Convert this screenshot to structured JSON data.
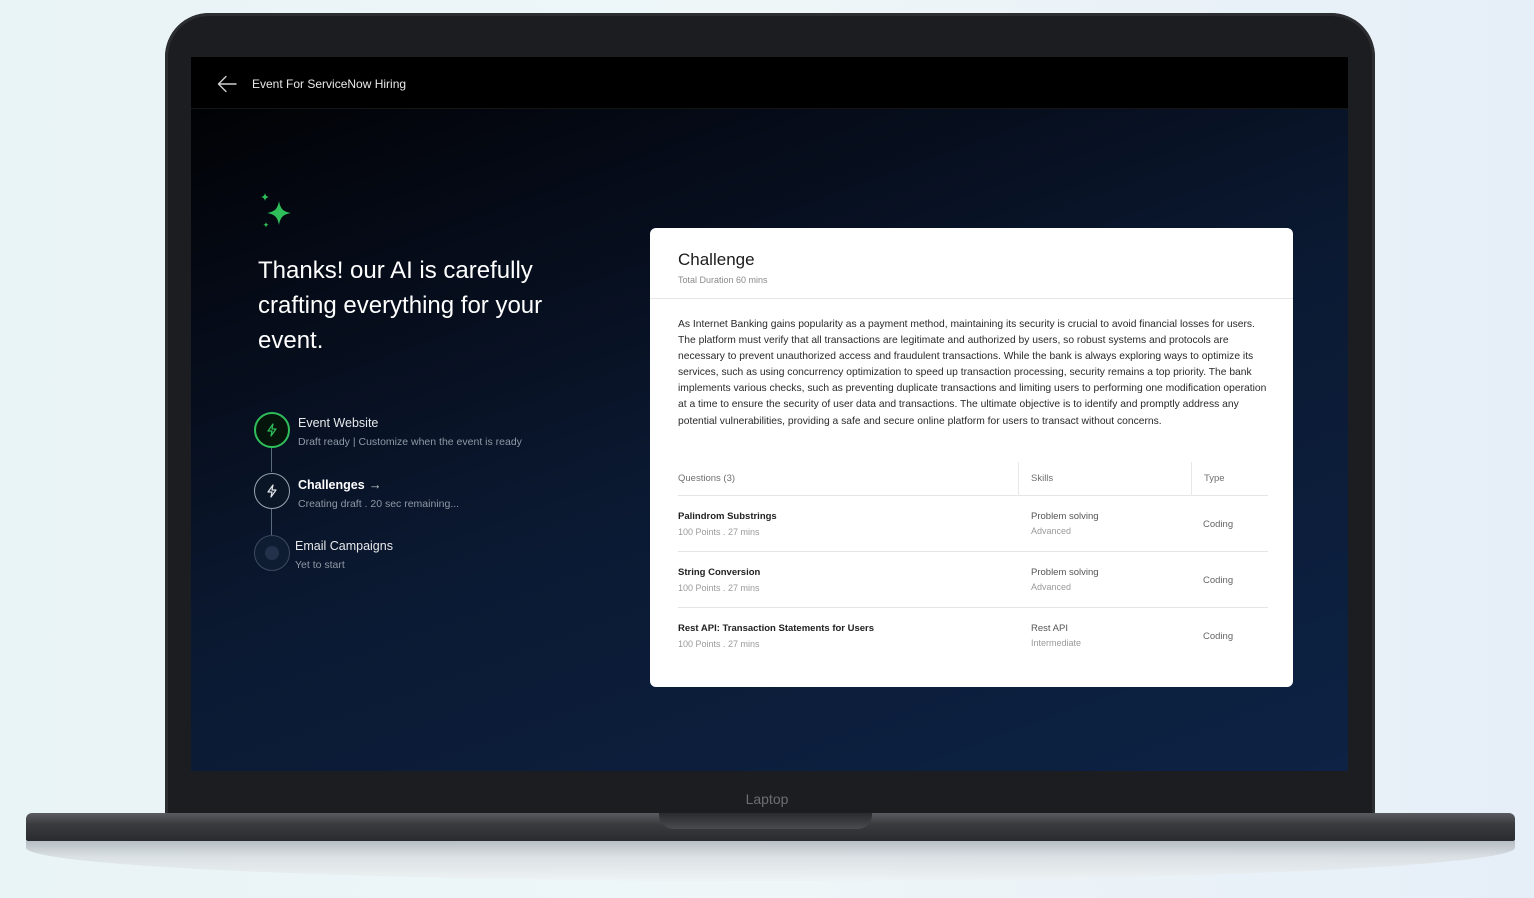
{
  "window": {
    "title": "Event For ServiceNow Hiring",
    "device_label": "Laptop"
  },
  "hero": {
    "headline": "Thanks! our AI is carefully crafting everything for your event."
  },
  "steps": [
    {
      "title": "Event Website",
      "subtitle": "Draft ready | Customize when the event is ready",
      "status": "done"
    },
    {
      "title": "Challenges",
      "subtitle": "Creating draft  .  20 sec remaining...",
      "status": "active",
      "arrow": "→"
    },
    {
      "title": "Email Campaigns",
      "subtitle": "Yet to start",
      "status": "pending"
    }
  ],
  "challenge": {
    "title": "Challenge",
    "duration": "Total Duration 60 mins",
    "description": "As Internet Banking gains popularity as a payment method, maintaining its security is crucial to avoid financial losses for users. The platform must verify that all transactions are legitimate and authorized by users, so robust systems and protocols are necessary to prevent unauthorized access and fraudulent transactions. While the bank is always exploring ways to optimize its services, such as using concurrency optimization to speed up transaction processing, security remains a top priority. The bank implements various checks, such as preventing duplicate transactions and limiting users to performing one modification operation at a time to ensure the security of user data and transactions. The ultimate objective is to identify and promptly address any potential vulnerabilities, providing a safe and secure online platform for users to transact without concerns.",
    "table": {
      "headers": {
        "questions": "Questions (3)",
        "skills": "Skills",
        "type": "Type"
      },
      "rows": [
        {
          "name": "Palindrom Substrings",
          "meta": "100 Points  .  27 mins",
          "skill": "Problem solving",
          "level": "Advanced",
          "type": "Coding"
        },
        {
          "name": "String Conversion",
          "meta": "100 Points  .  27 mins",
          "skill": "Problem solving",
          "level": "Advanced",
          "type": "Coding"
        },
        {
          "name": "Rest API: Transaction Statements for Users",
          "meta": "100 Points  .  27 mins",
          "skill": "Rest API",
          "level": "Intermediate",
          "type": "Coding"
        }
      ]
    }
  },
  "colors": {
    "accent_green": "#2fbf5a",
    "screen_bg": "#0b1a33",
    "card_bg": "#ffffff"
  },
  "icons": {
    "back": "arrow-left-icon",
    "sparkle": "sparkle-icon",
    "step": "lightning-icon"
  }
}
